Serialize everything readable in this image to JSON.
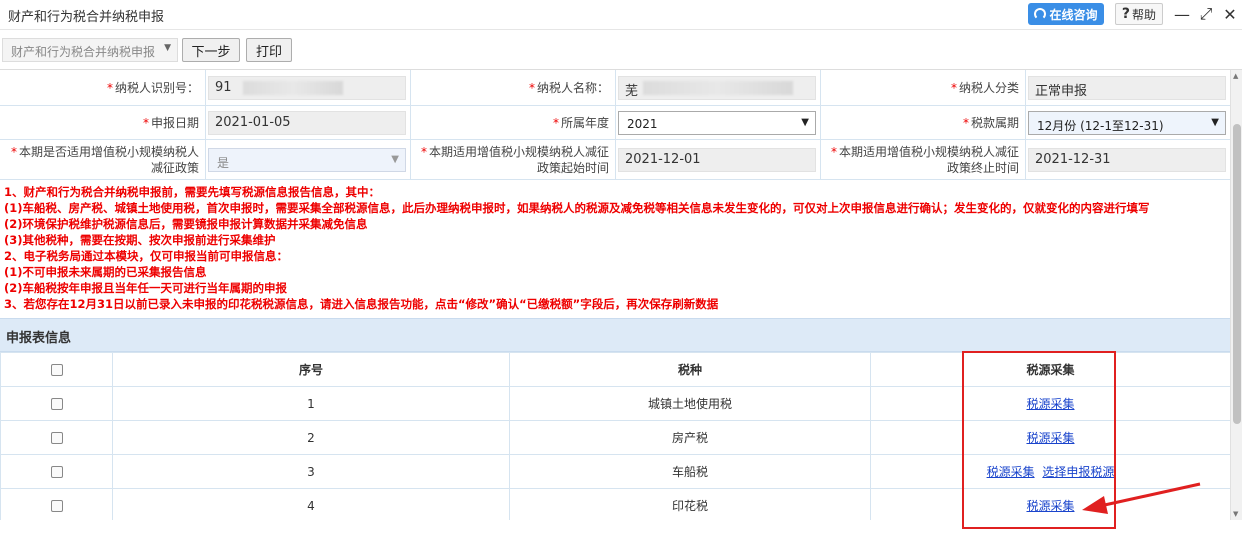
{
  "window": {
    "title": "财产和行为税合并纳税申报",
    "consult_label": "在线咨询",
    "help_label": "帮助",
    "minimize_glyph": "—",
    "maximize_glyph": "⤢",
    "close_glyph": "✕"
  },
  "toolbar": {
    "form_select_value": "财产和行为税合并纳税申报",
    "next_label": "下一步",
    "print_label": "打印"
  },
  "form": {
    "taxpayer_id_label": "纳税人识别号：",
    "taxpayer_id_value": "91",
    "taxpayer_name_label": "纳税人名称：",
    "taxpayer_name_value": "芜",
    "taxpayer_category_label": "纳税人分类",
    "taxpayer_category_value": "正常申报",
    "declare_date_label": "申报日期",
    "declare_date_value": "2021-01-05",
    "year_label": "所属年度",
    "year_value": "2021",
    "period_label": "税款属期",
    "period_value": "12月份 (12-1至12-31)",
    "small_scale_label_1": "本期是否适用增值税小规模纳税人",
    "small_scale_label_2": "减征政策",
    "small_scale_value": "是",
    "policy_start_label_1": "本期适用增值税小规模纳税人减征",
    "policy_start_label_2": "政策起始时间",
    "policy_start_value": "2021-12-01",
    "policy_end_label_1": "本期适用增值税小规模纳税人减征",
    "policy_end_label_2": "政策终止时间",
    "policy_end_value": "2021-12-31"
  },
  "notes": [
    "1、财产和行为税合并纳税申报前，需要先填写税源信息报告信息，其中：",
    "(1)车船税、房产税、城镇土地使用税，首次申报时，需要采集全部税源信息，此后办理纳税申报时，如果纳税人的税源及减免税等相关信息未发生变化的，可仅对上次申报信息进行确认；发生变化的，仅就变化的内容进行填写",
    "(2)环境保护税维护税源信息后，需要镜报申报计算数据并采集减免信息",
    "(3)其他税种，需要在按期、按次申报前进行采集维护",
    "2、电子税务局通过本模块，仅可申报当前可申报信息：",
    "(1)不可申报未来属期的已采集报告信息",
    "(2)车船税按年申报且当年任一天可进行当年属期的申报",
    "3、若您存在12月31日以前已录入未申报的印花税税源信息，请进入信息报告功能，点击“修改”确认“已缴税额”字段后，再次保存刷新数据"
  ],
  "section_title": "申报表信息",
  "table": {
    "headers": [
      "序号",
      "税种",
      "税源采集"
    ],
    "rows": [
      {
        "seq": "1",
        "tax": "城镇土地使用税",
        "links": [
          "税源采集"
        ]
      },
      {
        "seq": "2",
        "tax": "房产税",
        "links": [
          "税源采集"
        ]
      },
      {
        "seq": "3",
        "tax": "车船税",
        "links": [
          "税源采集",
          "选择申报税源"
        ]
      },
      {
        "seq": "4",
        "tax": "印花税",
        "links": [
          "税源采集"
        ]
      }
    ]
  },
  "colors": {
    "accent_blue": "#3a8ee6",
    "note_red": "#e00000",
    "section_bg": "#ddeaf7",
    "link_blue": "#1a44cc",
    "highlight_red": "#e02020"
  }
}
